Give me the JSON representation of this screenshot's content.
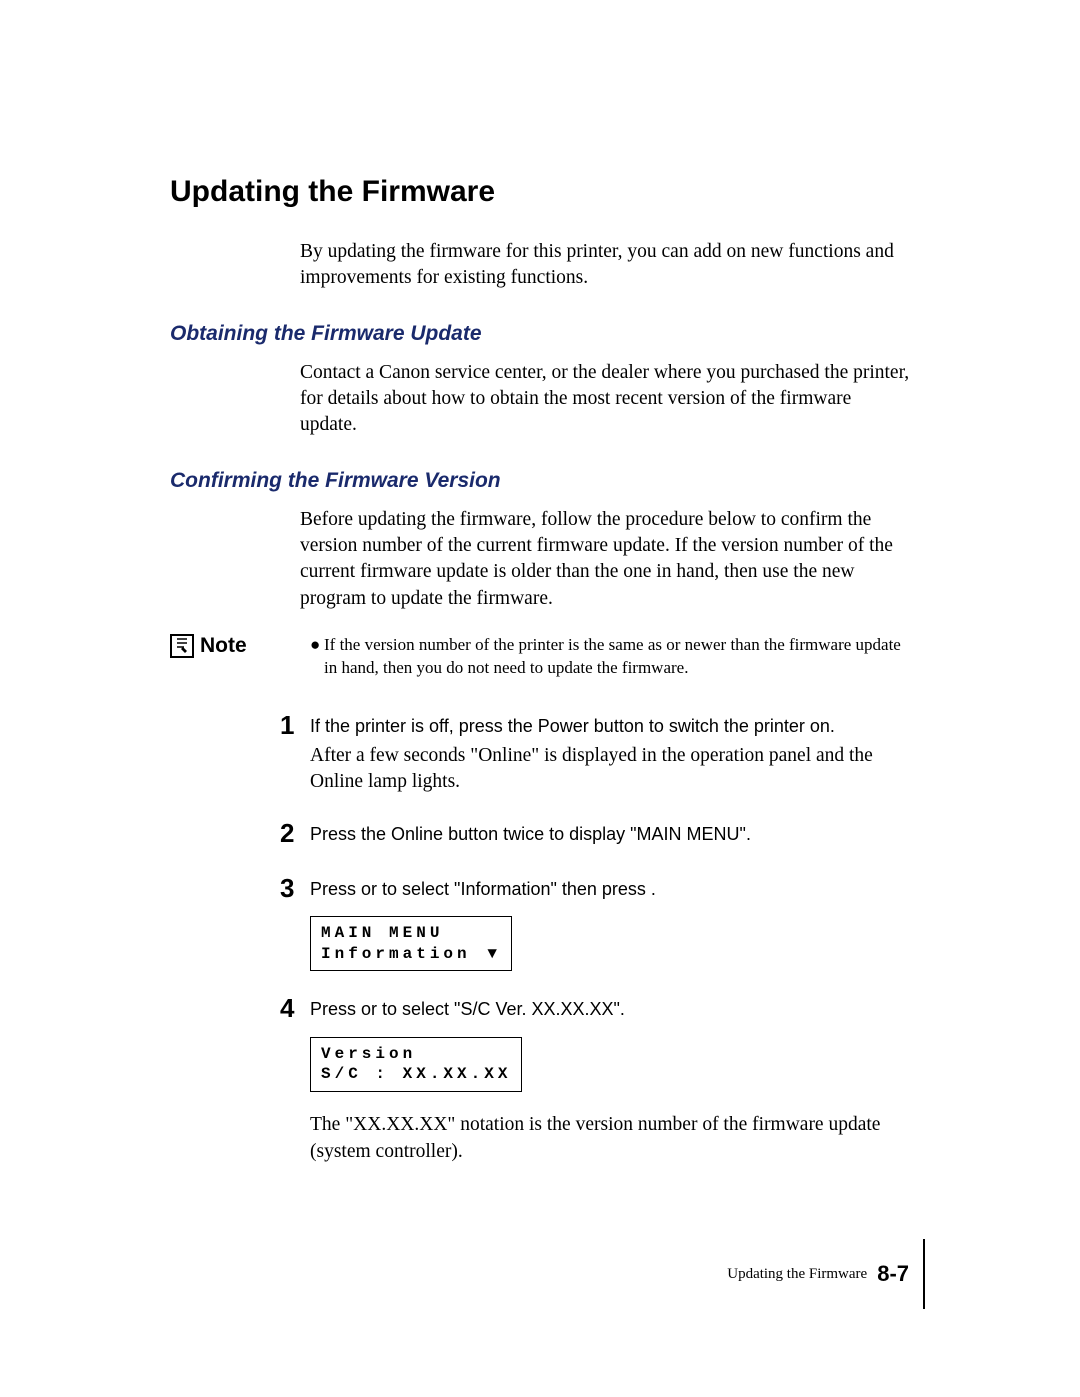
{
  "title": "Updating the Firmware",
  "intro": "By updating the firmware for this printer, you can add on new functions and improvements for existing functions.",
  "section1": {
    "heading": "Obtaining the Firmware Update",
    "body": "Contact a Canon service center, or the dealer where you purchased the printer, for details about how to obtain the most recent version of the firmware update."
  },
  "section2": {
    "heading": "Confirming the Firmware Version",
    "body": "Before updating the firmware, follow the procedure below to confirm the version number of the current firmware update. If the version number of the current firmware update is older than the one in hand, then use the new program to update the firmware."
  },
  "note": {
    "label": "Note",
    "body": "If the version number of the printer is the same as or newer than the firmware update in hand, then you do not need to update the firmware."
  },
  "steps": [
    {
      "num": "1",
      "head": "If the printer is off, press the Power button to switch the printer on.",
      "text": "After a few seconds \"Online\" is displayed in the operation panel and the Online lamp lights."
    },
    {
      "num": "2",
      "head": "Press the Online button twice to display \"MAIN MENU\"."
    },
    {
      "num": "3",
      "head": "Press     or     to select \"Information\" then press    .",
      "lcd": {
        "line1": "MAIN MENU",
        "line2": "Information",
        "arrow": "▼"
      }
    },
    {
      "num": "4",
      "head": "Press     or     to select \"S/C Ver. XX.XX.XX\".",
      "lcd": {
        "line1": "Version",
        "line2": "S/C  : XX.XX.XX"
      },
      "text": "The \"XX.XX.XX\" notation is the version number of the firmware update (system controller)."
    }
  ],
  "footer": {
    "text": "Updating the Firmware",
    "page": "8-7"
  }
}
